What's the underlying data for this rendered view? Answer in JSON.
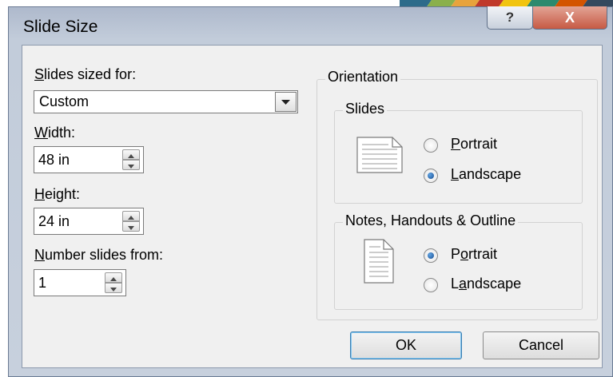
{
  "dialog": {
    "title": "Slide Size",
    "help_glyph": "?",
    "close_glyph": "X"
  },
  "slides_sized_for": {
    "label_access": "S",
    "label_rest": "lides sized for:",
    "selected": "Custom"
  },
  "width": {
    "label_access": "W",
    "label_rest": "idth:",
    "value": "48 in"
  },
  "height": {
    "label_access": "H",
    "label_rest": "eight:",
    "value": "24 in"
  },
  "number_slides_from": {
    "label_access": "N",
    "label_rest": "umber slides from:",
    "value": "1"
  },
  "orientation": {
    "title": "Orientation",
    "slides": {
      "title": "Slides",
      "portrait": {
        "pre": "",
        "access": "P",
        "post": "ortrait",
        "selected": false
      },
      "landscape": {
        "pre": "",
        "access": "L",
        "post": "andscape",
        "selected": true
      }
    },
    "notes": {
      "title": "Notes, Handouts & Outline",
      "portrait": {
        "pre": "P",
        "access": "o",
        "post": "rtrait",
        "selected": true
      },
      "landscape": {
        "pre": "L",
        "access": "a",
        "post": "ndscape",
        "selected": false
      }
    }
  },
  "buttons": {
    "ok": "OK",
    "cancel": "Cancel"
  },
  "colors": {
    "selected_radio": "#1a4f91",
    "default_button_border": "#3c7fb1",
    "close_button": "#c75a44"
  }
}
